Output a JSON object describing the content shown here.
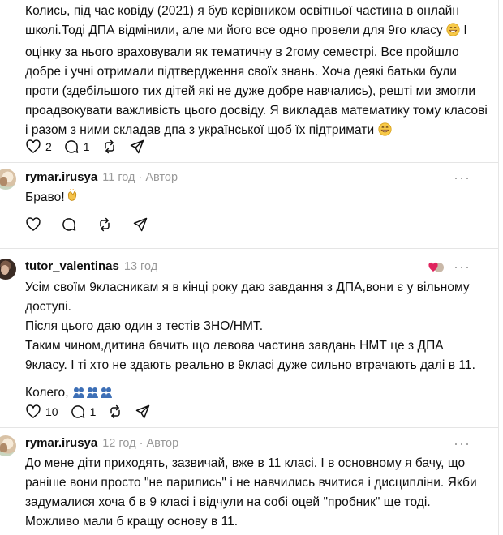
{
  "top_post": {
    "text": "Колись, під час ковіду (2021) я був керівником освітньої частина в онлайн школі.Тоді ДПА відмінили, але ми його все одно провели для 9го класу",
    "text_lines": [
      "Колись, під час ковіду (2021) я був керівником освітньої частина в онлайн",
      "школі.Тоді ДПА відмінили, але ми його все одно провели для 9го класу",
      "оцінку за нього враховували як тематичну в 2гому семестрі. Все пройшло",
      "добре і учні отримали підтвердження своїх знань. Хоча деякі батьки були",
      "проти (здебільшого тих дітей які не дуже добре навчались), решті ми змогли",
      "проадвокувати важливість цього досвіду. Я викладав математику тому класові",
      "і разом з ними складав дпа з української щоб їх підтримати"
    ],
    "likes": "2",
    "replies": "1"
  },
  "comments": [
    {
      "username": "rymar.irusya",
      "time": "11 год",
      "role": "· Автор",
      "text": "Браво!",
      "emoji": "clapping-hands",
      "likes": "",
      "replies": ""
    },
    {
      "username": "tutor_valentinas",
      "time": "13 год",
      "role": "",
      "lines": [
        "Усім своїм 9класникам я в кінці року даю завдання з ДПА,вони є у вільному",
        "доступі.",
        "Після цього даю один з тестів ЗНО/НМТ.",
        "Таким чином,дитина бачить що левова частина завдань НМТ це з ДПА",
        "9класу. І ті хто не здають реально в 9класі дуже сильно втрачають далі в 11."
      ],
      "closing": "Колего,",
      "likes": "10",
      "replies": "1"
    },
    {
      "username": "rymar.irusya",
      "time": "12 год",
      "role": "· Автор",
      "lines": [
        "До мене діти приходять, зазвичай, вже в 11 класі. І в основному я бачу, що",
        "раніше вони просто \"не парились\" і не навчились вчитися і дисципліни. Якби",
        "задумалися хоча б в 9 класі і відчули на собі оцей \"пробник\" ще тоді.",
        "Можливо мали б кращу основу в 11."
      ]
    }
  ],
  "icons": {
    "like": "heart-icon",
    "reply": "speech-bubble-icon",
    "repost": "repost-icon",
    "share": "send-icon",
    "more": "more-dots-icon"
  }
}
